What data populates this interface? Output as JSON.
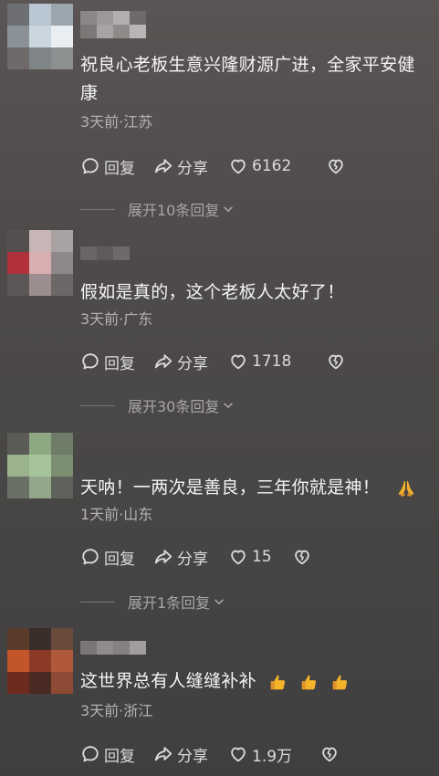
{
  "comments": [
    {
      "text": "祝良心老板生意兴隆财源广进，全家平安健康",
      "meta": "3天前·江苏",
      "reply_label": "回复",
      "share_label": "分享",
      "likes": "6162",
      "expand_label": "展开10条回复"
    },
    {
      "text": "假如是真的，这个老板人太好了！",
      "meta": "3天前·广东",
      "reply_label": "回复",
      "share_label": "分享",
      "likes": "1718",
      "expand_label": "展开30条回复"
    },
    {
      "text": "天呐！一两次是善良，三年你就是神！",
      "meta": "1天前·山东",
      "reply_label": "回复",
      "share_label": "分享",
      "likes": "15",
      "expand_label": "展开1条回复"
    },
    {
      "text": "这世界总有人缝缝补补",
      "meta": "3天前·浙江",
      "reply_label": "回复",
      "share_label": "分享",
      "likes": "1.9万"
    }
  ],
  "icons": {
    "reply": "comment-bubble-icon",
    "share": "share-arrow-icon",
    "like": "heart-icon",
    "dislike": "broken-heart-icon",
    "expand": "chevron-down-icon"
  },
  "colors": {
    "background": "#4c4848",
    "text": "#f4f4f4",
    "meta": "#b4b1b1",
    "emoji": "#f5b32a"
  }
}
